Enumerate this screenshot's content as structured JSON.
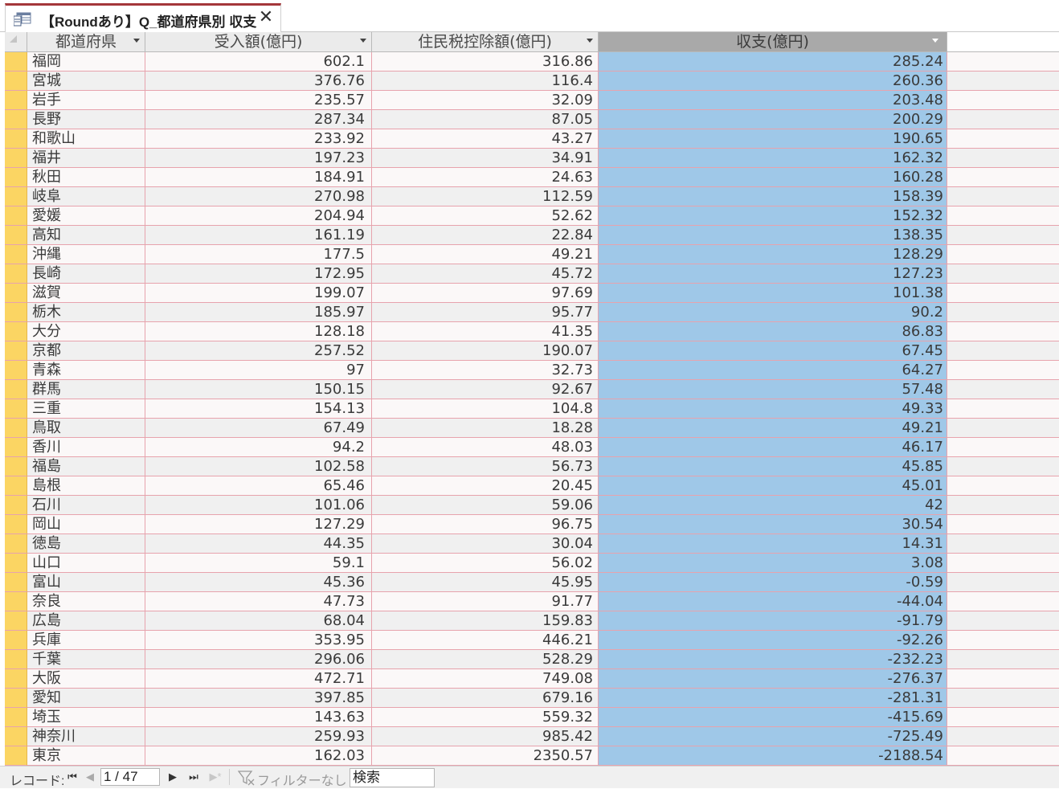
{
  "tab": {
    "title": "【Roundあり】Q_都道府県別 収支",
    "close_glyph": "✕"
  },
  "columns": [
    "都道府県",
    "受入額(億円)",
    "住民税控除額(億円)",
    "収支(億円)"
  ],
  "rows": [
    [
      "福岡",
      "602.1",
      "316.86",
      "285.24"
    ],
    [
      "宮城",
      "376.76",
      "116.4",
      "260.36"
    ],
    [
      "岩手",
      "235.57",
      "32.09",
      "203.48"
    ],
    [
      "長野",
      "287.34",
      "87.05",
      "200.29"
    ],
    [
      "和歌山",
      "233.92",
      "43.27",
      "190.65"
    ],
    [
      "福井",
      "197.23",
      "34.91",
      "162.32"
    ],
    [
      "秋田",
      "184.91",
      "24.63",
      "160.28"
    ],
    [
      "岐阜",
      "270.98",
      "112.59",
      "158.39"
    ],
    [
      "愛媛",
      "204.94",
      "52.62",
      "152.32"
    ],
    [
      "高知",
      "161.19",
      "22.84",
      "138.35"
    ],
    [
      "沖縄",
      "177.5",
      "49.21",
      "128.29"
    ],
    [
      "長崎",
      "172.95",
      "45.72",
      "127.23"
    ],
    [
      "滋賀",
      "199.07",
      "97.69",
      "101.38"
    ],
    [
      "栃木",
      "185.97",
      "95.77",
      "90.2"
    ],
    [
      "大分",
      "128.18",
      "41.35",
      "86.83"
    ],
    [
      "京都",
      "257.52",
      "190.07",
      "67.45"
    ],
    [
      "青森",
      "97",
      "32.73",
      "64.27"
    ],
    [
      "群馬",
      "150.15",
      "92.67",
      "57.48"
    ],
    [
      "三重",
      "154.13",
      "104.8",
      "49.33"
    ],
    [
      "鳥取",
      "67.49",
      "18.28",
      "49.21"
    ],
    [
      "香川",
      "94.2",
      "48.03",
      "46.17"
    ],
    [
      "福島",
      "102.58",
      "56.73",
      "45.85"
    ],
    [
      "島根",
      "65.46",
      "20.45",
      "45.01"
    ],
    [
      "石川",
      "101.06",
      "59.06",
      "42"
    ],
    [
      "岡山",
      "127.29",
      "96.75",
      "30.54"
    ],
    [
      "徳島",
      "44.35",
      "30.04",
      "14.31"
    ],
    [
      "山口",
      "59.1",
      "56.02",
      "3.08"
    ],
    [
      "富山",
      "45.36",
      "45.95",
      "-0.59"
    ],
    [
      "奈良",
      "47.73",
      "91.77",
      "-44.04"
    ],
    [
      "広島",
      "68.04",
      "159.83",
      "-91.79"
    ],
    [
      "兵庫",
      "353.95",
      "446.21",
      "-92.26"
    ],
    [
      "千葉",
      "296.06",
      "528.29",
      "-232.23"
    ],
    [
      "大阪",
      "472.71",
      "749.08",
      "-276.37"
    ],
    [
      "愛知",
      "397.85",
      "679.16",
      "-281.31"
    ],
    [
      "埼玉",
      "143.63",
      "559.32",
      "-415.69"
    ],
    [
      "神奈川",
      "259.93",
      "985.42",
      "-725.49"
    ],
    [
      "東京",
      "162.03",
      "2350.57",
      "-2188.54"
    ]
  ],
  "selected_column_color": "#9fc8e8",
  "row_selector_color": "#fbd563",
  "tab_accent_color": "#a4373a",
  "nav": {
    "label": "レコード:",
    "record": "1 / 47",
    "filter_label": "フィルターなし",
    "search": "検索",
    "first_glyph": "⏮",
    "prev_glyph": "◀",
    "next_glyph": "▶",
    "last_glyph": "⏭",
    "new_glyph": "▶*"
  }
}
